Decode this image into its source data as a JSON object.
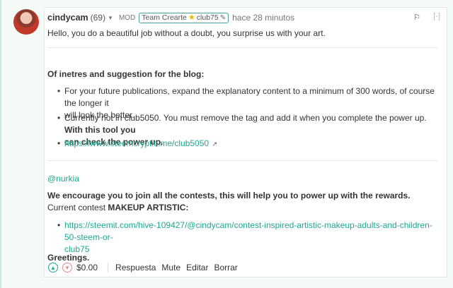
{
  "comment": {
    "author": "cindycam",
    "reputation": "(69)",
    "role": "MOD",
    "community_label": "Team Crearte",
    "community_tag": "club75",
    "time": "hace 28 minutos",
    "greeting": "Hello, you do a beautiful job without a doubt, you surprise us with your art.",
    "section_title": "Of inetres and suggestion for the blog:",
    "suggestions": [
      "For your future publications, expand the explanatory content to a minimum of 300 words, of course the longer it",
      "will look the better.",
      "Currently not in club5050. You must remove the tag and add it when you complete the power up.",
      "With this tool you",
      "can check the power up."
    ],
    "tool_link": "https://www.steemcryptic.me/club5050",
    "mention": "@nurkia",
    "encourage": "We encourage you to join all the contests, this will help you to power up with the rewards.",
    "current_contest_prefix": "Current contest",
    "current_contest_name": "MAKEUP ARTISTIC:",
    "contest_link_line1": "https://steemit.com/hive-109427/@cindycam/contest-inspired-artistic-makeup-adults-and-children-50-steem-or-",
    "contest_link_line2": "club75",
    "closing": "Greetings."
  },
  "footer": {
    "payout": "$0.00",
    "reply": "Respuesta",
    "mute": "Mute",
    "edit": "Editar",
    "delete": "Borrar"
  },
  "icons": {
    "upvote": "chevron-up-icon",
    "downvote": "chevron-down-icon",
    "flag": "flag-icon",
    "collapse": "collapse-icon",
    "external": "external-link-icon"
  },
  "colors": {
    "link": "#1ea891",
    "community_border": "#4ba2a2",
    "downvote": "#e98a8a",
    "star": "#f4b400"
  }
}
